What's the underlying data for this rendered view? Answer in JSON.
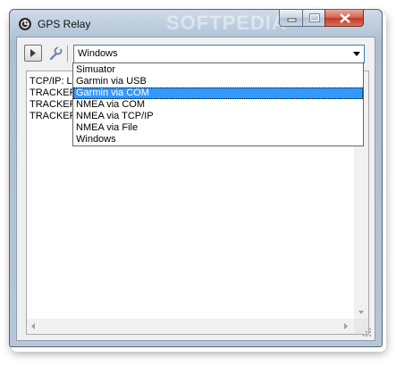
{
  "window": {
    "title": "GPS Relay",
    "watermark": "SOFTPEDIA"
  },
  "toolbar": {
    "source_selected": "Windows"
  },
  "log": {
    "lines": [
      "TCP/IP: Li",
      "TRACKER",
      "TRACKER",
      "TRACKER"
    ]
  },
  "dropdown": {
    "options": [
      "Simuator",
      "Garmin via USB",
      "Garmin via COM",
      "NMEA via COM",
      "NMEA via TCP/IP",
      "NMEA via File",
      "Windows"
    ],
    "highlighted": "Garmin via COM"
  },
  "colors": {
    "selection": "#3399ff",
    "close_button": "#c13a27"
  },
  "icons": {
    "app": "satellite-icon",
    "play": "play-icon",
    "settings": "wrench-icon"
  }
}
